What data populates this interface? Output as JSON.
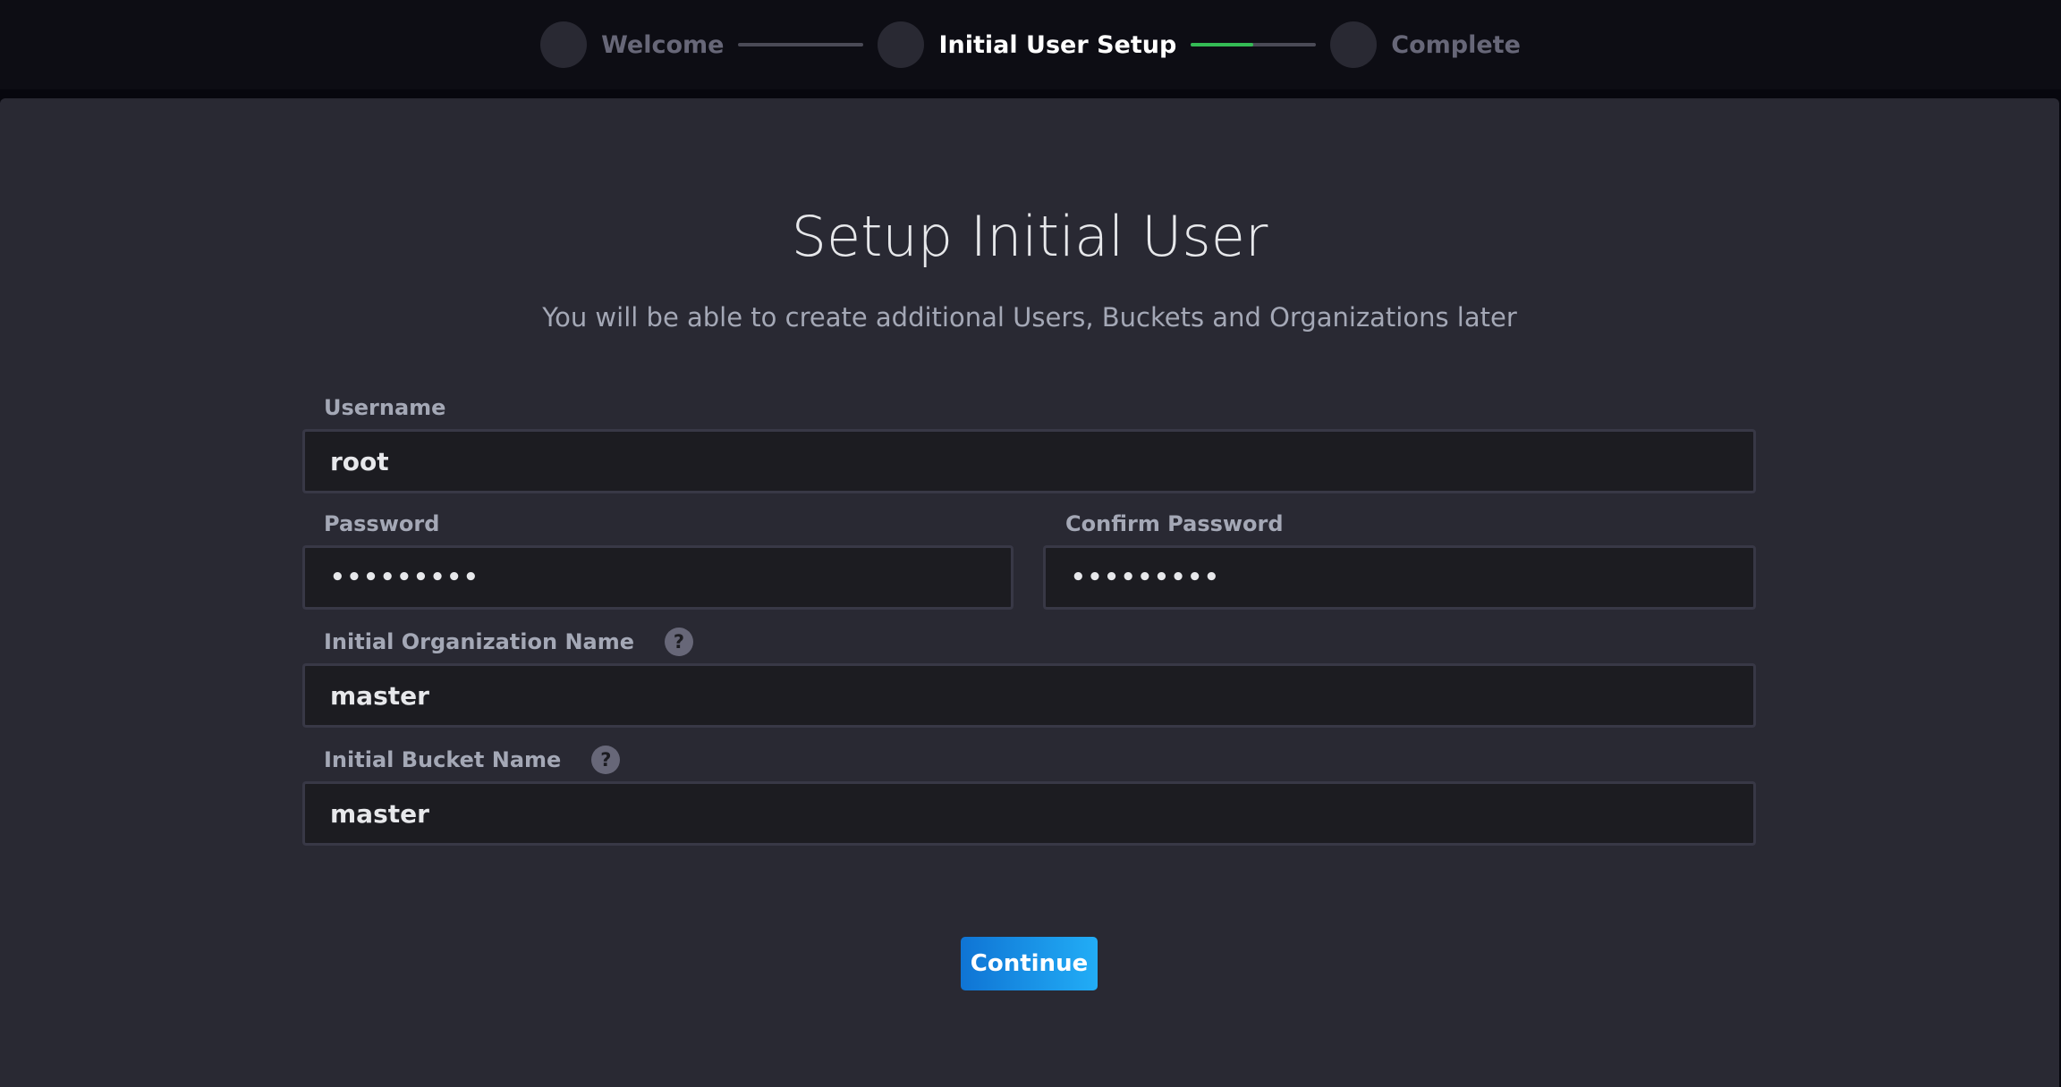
{
  "stepper": {
    "steps": [
      {
        "label": "Welcome"
      },
      {
        "label": "Initial User Setup"
      },
      {
        "label": "Complete"
      }
    ],
    "progress_fraction": 0.5,
    "colors": {
      "active": "#ffffff",
      "inactive": "#676778",
      "progress": "#34bb55"
    }
  },
  "page": {
    "title": "Setup Initial User",
    "subtitle": "You will be able to create additional Users, Buckets and Organizations later"
  },
  "form": {
    "username": {
      "label": "Username",
      "value": "root"
    },
    "password": {
      "label": "Password",
      "value": "•••••••••"
    },
    "confirm_password": {
      "label": "Confirm Password",
      "value": "•••••••••"
    },
    "org_name": {
      "label": "Initial Organization Name",
      "value": "master",
      "help_icon": "question-circle-icon",
      "help_glyph": "?"
    },
    "bucket_name": {
      "label": "Initial Bucket Name",
      "value": "master",
      "help_icon": "question-circle-icon",
      "help_glyph": "?"
    },
    "continue_label": "Continue"
  }
}
